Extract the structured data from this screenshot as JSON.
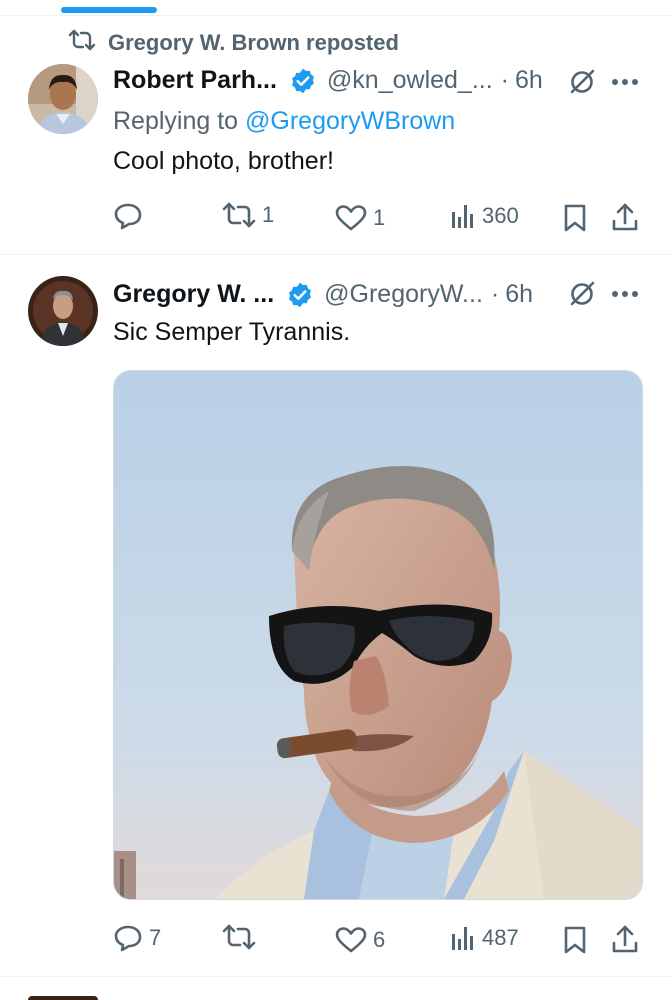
{
  "colors": {
    "accent": "#1d9bf0",
    "secondary_text": "#536471",
    "primary_text": "#0f1419"
  },
  "repost_banner": {
    "icon": "repost-icon",
    "text": "Gregory W. Brown reposted"
  },
  "tweets": [
    {
      "author_name": "Robert Parh...",
      "handle": "@kn_owled_...",
      "separator": "·",
      "time": "6h",
      "replying_prefix": "Replying to",
      "replying_to": "@GregoryWBrown",
      "text": "Cool photo, brother!",
      "actions": {
        "replies": "",
        "reposts": "1",
        "likes": "1",
        "views": "360"
      }
    },
    {
      "author_name": "Gregory W. ...",
      "handle": "@GregoryW...",
      "separator": "·",
      "time": "6h",
      "text": "Sic Semper Tyrannis.",
      "actions": {
        "replies": "7",
        "reposts": "",
        "likes": "6",
        "views": "487"
      }
    }
  ]
}
